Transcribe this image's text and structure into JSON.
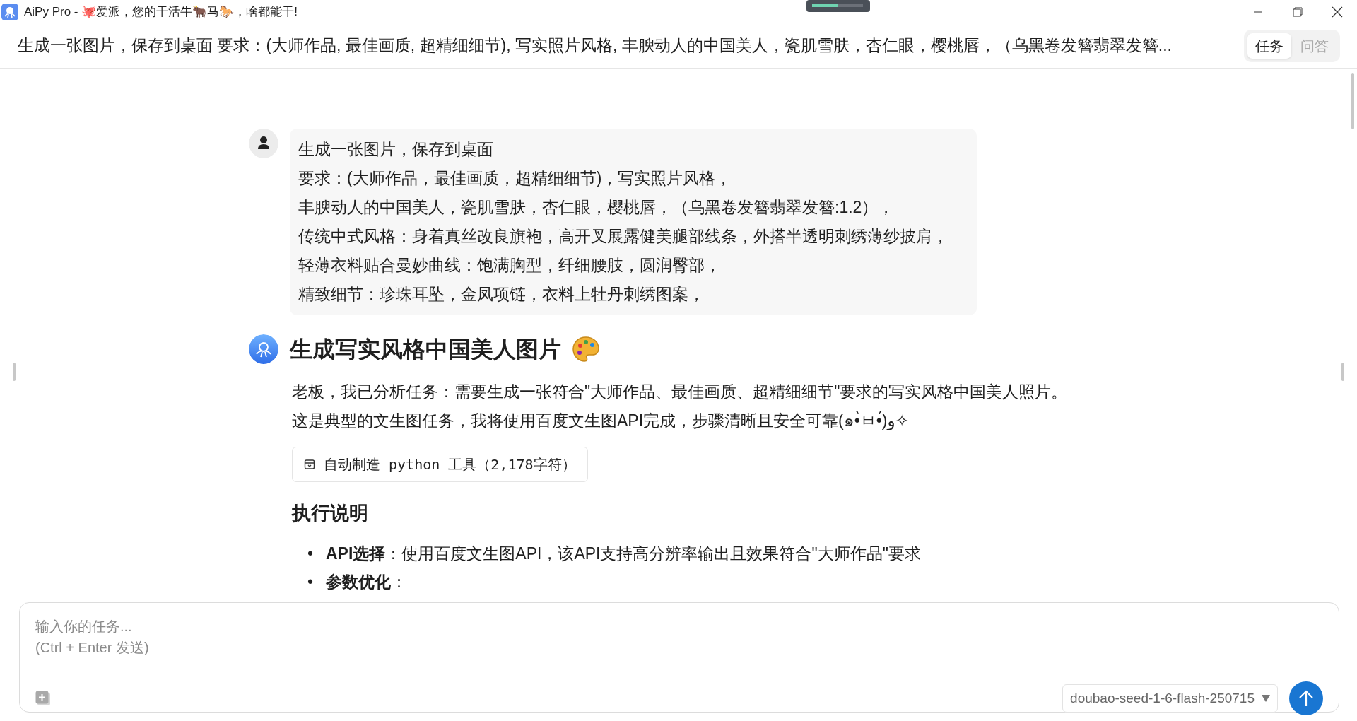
{
  "window": {
    "title": "AiPy Pro - 🐙爱派，您的干活牛🐂马🐎，啥都能干!"
  },
  "header": {
    "task_title": "生成一张图片，保存到桌面 要求：(大师作品, 最佳画质, 超精细细节), 写实照片风格, 丰腴动人的中国美人，瓷肌雪肤，杏仁眼，樱桃唇，（乌黑卷发簪翡翠发簪...",
    "tabs": [
      {
        "label": "任务",
        "selected": true
      },
      {
        "label": "问答",
        "selected": false
      }
    ]
  },
  "messages": [
    {
      "kind": "user",
      "lines": [
        "生成一张图片，保存到桌面",
        "要求：(大师作品，最佳画质，超精细细节)，写实照片风格，",
        "丰腴动人的中国美人，瓷肌雪肤，杏仁眼，樱桃唇，（乌黑卷发簪翡翠发簪:1.2），",
        "传统中式风格：身着真丝改良旗袍，高开叉展露健美腿部线条，外搭半透明刺绣薄纱披肩，",
        "轻薄衣料贴合曼妙曲线：饱满胸型，纤细腰肢，圆润臀部，",
        "精致细节：珍珠耳坠，金凤项链，衣料上牡丹刺绣图案，"
      ]
    },
    {
      "kind": "assistant",
      "heading": "生成写实风格中国美人图片",
      "intro": "老板，我已分析任务：需要生成一张符合\"大师作品、最佳画质、超精细细节\"要求的写实风格中国美人照片。这是典型的文生图任务，我将使用百度文生图API完成，步骤清晰且安全可靠(๑•̀ㅂ•́)و✧",
      "tool": "自动制造 python 工具（2,178字符）",
      "section": "执行说明",
      "bullets": [
        {
          "marker": "•",
          "text": "**API选择**：使用百度文生图API，该API支持高分辨率输出且效果符合\"大师作品\"要求"
        },
        {
          "marker": "•",
          "text": "**参数优化**："
        }
      ]
    }
  ],
  "composer": {
    "placeholder": "输入你的任务...\n(Ctrl + Enter 发送)",
    "model": "doubao-seed-1-6-flash-250715"
  }
}
